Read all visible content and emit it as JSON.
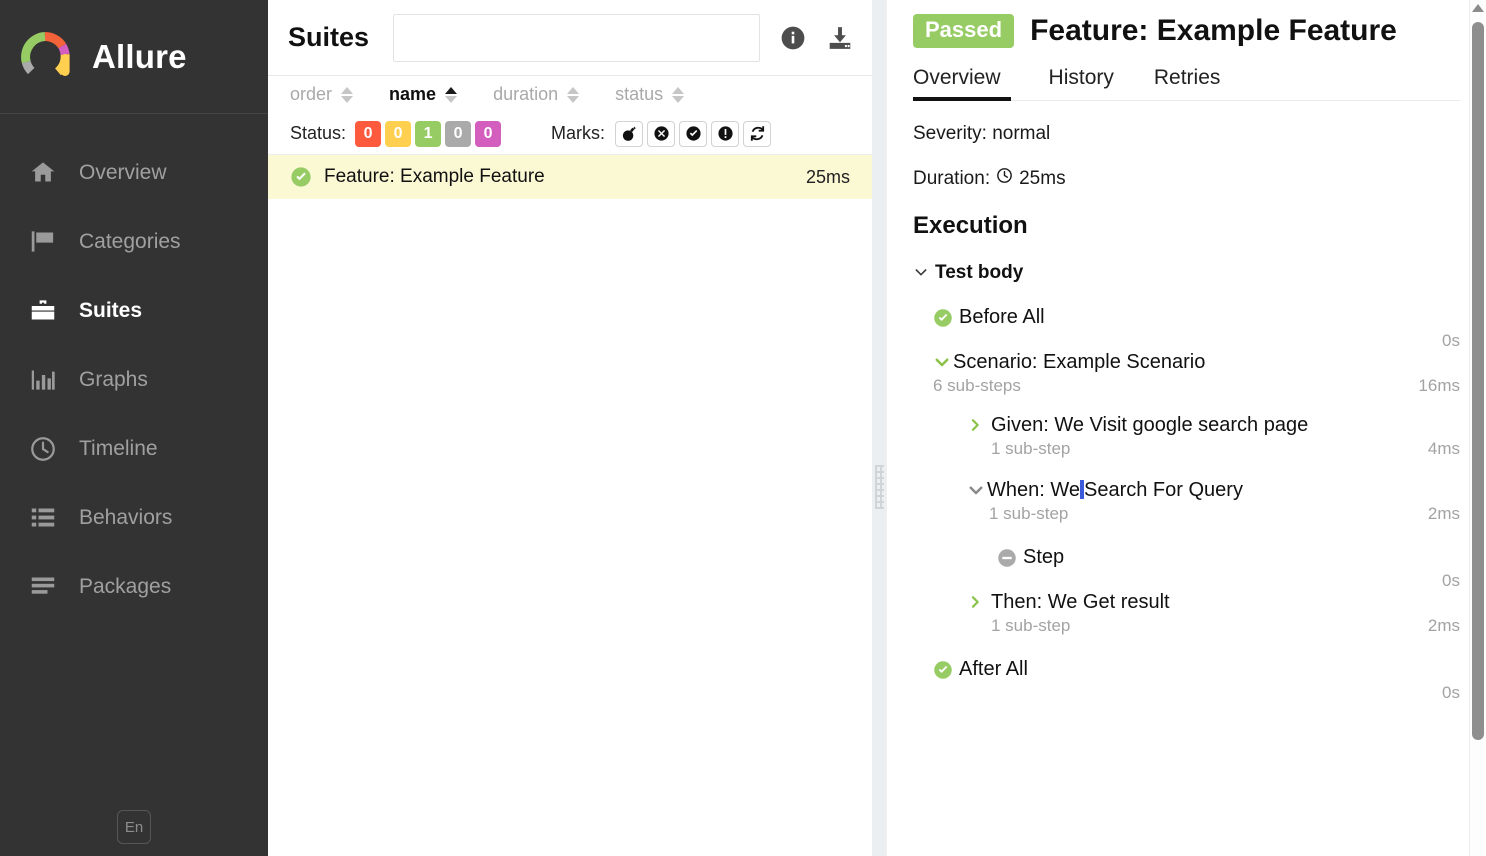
{
  "app": {
    "brand": "Allure",
    "language_button": "En"
  },
  "sidebar": {
    "items": [
      {
        "label": "Overview",
        "icon": "home-icon",
        "active": false
      },
      {
        "label": "Categories",
        "icon": "flag-icon",
        "active": false
      },
      {
        "label": "Suites",
        "icon": "briefcase-icon",
        "active": true
      },
      {
        "label": "Graphs",
        "icon": "bar-chart-icon",
        "active": false
      },
      {
        "label": "Timeline",
        "icon": "clock-icon",
        "active": false
      },
      {
        "label": "Behaviors",
        "icon": "list-icon",
        "active": false
      },
      {
        "label": "Packages",
        "icon": "lines-icon",
        "active": false
      }
    ]
  },
  "suites": {
    "title": "Suites",
    "search_value": "",
    "search_placeholder": "",
    "info_icon": "info-icon",
    "download_icon": "download-icon",
    "sort_columns": [
      {
        "label": "order",
        "active": false
      },
      {
        "label": "name",
        "active": true
      },
      {
        "label": "duration",
        "active": false
      },
      {
        "label": "status",
        "active": false
      }
    ],
    "status_filter_label": "Status:",
    "status_badges": [
      {
        "count": "0",
        "color": "#fd5a3e",
        "name": "failed"
      },
      {
        "count": "0",
        "color": "#ffd050",
        "name": "broken"
      },
      {
        "count": "1",
        "color": "#97cc64",
        "name": "passed"
      },
      {
        "count": "0",
        "color": "#aaaaaa",
        "name": "skipped"
      },
      {
        "count": "0",
        "color": "#d35ebe",
        "name": "unknown"
      }
    ],
    "marks_label": "Marks:",
    "marks": [
      {
        "name": "bomb-icon"
      },
      {
        "name": "x-circle-icon"
      },
      {
        "name": "check-circle-icon"
      },
      {
        "name": "exclamation-circle-icon"
      },
      {
        "name": "refresh-icon"
      }
    ],
    "rows": [
      {
        "name": "Feature: Example Feature",
        "duration": "25ms",
        "status": "passed",
        "selected": true
      }
    ]
  },
  "detail": {
    "status_label": "Passed",
    "status_color": "#97cc64",
    "title": "Feature: Example Feature",
    "tabs": [
      {
        "label": "Overview",
        "active": true
      },
      {
        "label": "History",
        "active": false
      },
      {
        "label": "Retries",
        "active": false
      }
    ],
    "severity": "Severity: normal",
    "duration_label": "Duration:",
    "duration_value": "25ms",
    "execution_heading": "Execution",
    "tree": {
      "root_label": "Test body",
      "nodes": [
        {
          "label": "Before All",
          "icon": "check-circle-icon",
          "duration": "0s",
          "substeps": ""
        },
        {
          "label": "Scenario: Example Scenario",
          "icon": "chevron-down-green-icon",
          "duration": "16ms",
          "substeps": "6 sub-steps"
        },
        {
          "label": "Given: We Visit google search page",
          "icon": "chevron-right-green-icon",
          "duration": "4ms",
          "substeps": "1 sub-step"
        },
        {
          "label_before_caret": "When: We",
          "label_after_caret": "Search For Query",
          "icon": "chevron-down-gray-icon",
          "duration": "2ms",
          "substeps": "1 sub-step"
        },
        {
          "label": "Step",
          "icon": "minus-circle-icon",
          "duration": "0s",
          "substeps": ""
        },
        {
          "label": "Then: We Get result",
          "icon": "chevron-right-green-icon",
          "duration": "2ms",
          "substeps": "1 sub-step"
        },
        {
          "label": "After All",
          "icon": "check-circle-icon",
          "duration": "0s",
          "substeps": ""
        }
      ]
    }
  }
}
